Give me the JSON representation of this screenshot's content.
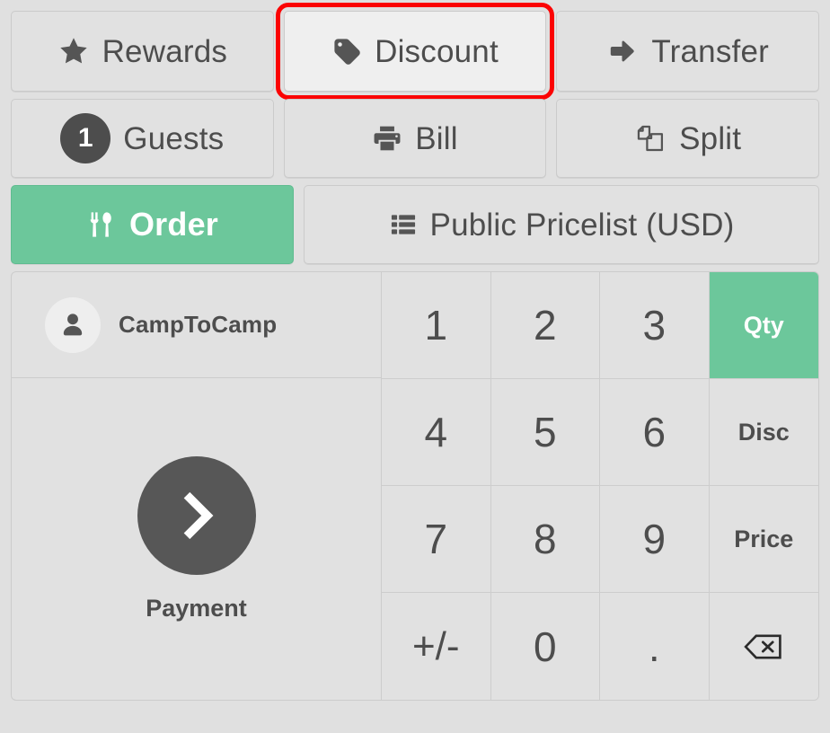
{
  "toolbar_rows": [
    {
      "row": "actions",
      "buttons": [
        {
          "label": "Rewards",
          "icon": "star-icon",
          "state": "normal"
        },
        {
          "label": "Discount",
          "icon": "tag-icon",
          "state": "hovered-highlighted"
        },
        {
          "label": "Transfer",
          "icon": "arrow-right-icon",
          "state": "normal"
        }
      ]
    },
    {
      "row": "order-tools",
      "buttons": [
        {
          "label": "Guests",
          "icon": "guest-count-badge",
          "badge": "1",
          "state": "normal"
        },
        {
          "label": "Bill",
          "icon": "printer-icon",
          "state": "normal"
        },
        {
          "label": "Split",
          "icon": "split-copy-icon",
          "state": "normal"
        }
      ]
    },
    {
      "row": "mode",
      "buttons": [
        {
          "label": "Order",
          "icon": "cutlery-icon",
          "state": "active"
        },
        {
          "label": "Public Pricelist (USD)",
          "icon": "list-icon",
          "state": "normal"
        }
      ]
    }
  ],
  "customer": {
    "name": "CampToCamp",
    "icon": "person-icon"
  },
  "payment": {
    "label": "Payment",
    "icon": "chevron-right-icon"
  },
  "numpad": {
    "keys": [
      {
        "label": "1",
        "kind": "digit",
        "state": "normal"
      },
      {
        "label": "2",
        "kind": "digit",
        "state": "normal"
      },
      {
        "label": "3",
        "kind": "digit",
        "state": "normal"
      },
      {
        "label": "Qty",
        "kind": "mode",
        "state": "active"
      },
      {
        "label": "4",
        "kind": "digit",
        "state": "normal"
      },
      {
        "label": "5",
        "kind": "digit",
        "state": "normal"
      },
      {
        "label": "6",
        "kind": "digit",
        "state": "normal"
      },
      {
        "label": "Disc",
        "kind": "mode",
        "state": "normal"
      },
      {
        "label": "7",
        "kind": "digit",
        "state": "normal"
      },
      {
        "label": "8",
        "kind": "digit",
        "state": "normal"
      },
      {
        "label": "9",
        "kind": "digit",
        "state": "normal"
      },
      {
        "label": "Price",
        "kind": "mode",
        "state": "normal"
      },
      {
        "label": "+/-",
        "kind": "sign",
        "state": "normal"
      },
      {
        "label": "0",
        "kind": "digit",
        "state": "normal"
      },
      {
        "label": ".",
        "kind": "dot",
        "state": "normal"
      },
      {
        "label": "",
        "kind": "backspace",
        "icon": "backspace-icon",
        "state": "normal"
      }
    ]
  },
  "colors": {
    "background": "#e0e0e0",
    "button_face": "#e1e1e1",
    "button_hover": "#efefef",
    "border": "#cccccc",
    "text": "#4d4d4d",
    "accent_green": "#6cc79b",
    "highlight_red": "#fb0303",
    "dark_circle": "#575757"
  }
}
